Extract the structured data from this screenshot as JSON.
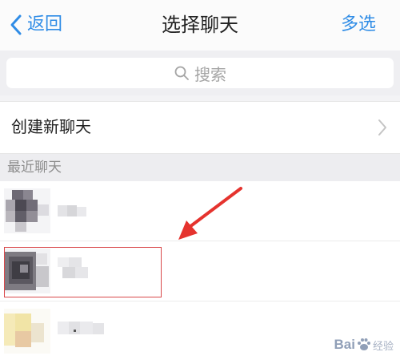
{
  "nav": {
    "back_label": "返回",
    "title": "选择聊天",
    "action_label": "多选"
  },
  "search": {
    "placeholder": "搜索"
  },
  "new_chat": {
    "label": "创建新聊天"
  },
  "recent": {
    "header": "最近聊天"
  },
  "colors": {
    "accent": "#2f8ce6",
    "highlight_border": "#d9484a",
    "arrow": "#e5332e"
  },
  "icons": {
    "back": "chevron-left-icon",
    "search": "search-icon",
    "disclosure": "chevron-right-icon",
    "annotation": "arrow-icon"
  }
}
